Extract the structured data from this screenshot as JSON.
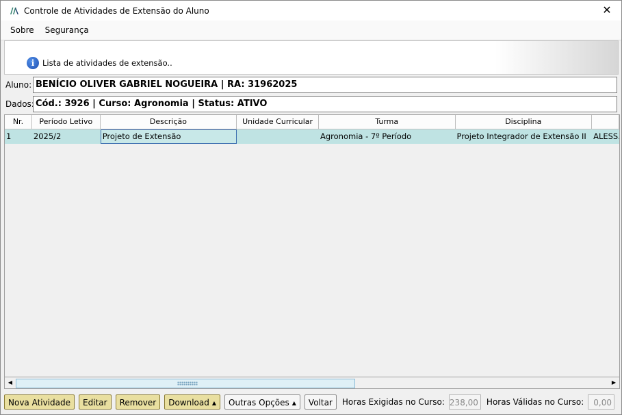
{
  "window": {
    "title": "Controle de Atividades de Extensão do Aluno",
    "close_glyph": "✕"
  },
  "menu": {
    "items": [
      "Sobre",
      "Segurança"
    ]
  },
  "info": {
    "icon": "info-icon",
    "text": "Lista de atividades de extensão.."
  },
  "student": {
    "aluno_label": "Aluno:",
    "aluno_value": "BENÍCIO OLIVER GABRIEL NOGUEIRA | RA: 31962025",
    "dados_label": "Dados:",
    "dados_value": "Cód.: 3926 | Curso: Agronomia | Status: ATIVO"
  },
  "grid": {
    "columns": [
      "Nr.",
      "Período Letivo",
      "Descrição",
      "Unidade Curricular",
      "Turma",
      "Disciplina",
      ""
    ],
    "rows": [
      [
        "1",
        "2025/2",
        "Projeto de Extensão",
        "",
        "Agronomia - 7º Período",
        "Projeto Integrador de Extensão II",
        "ALESS."
      ]
    ]
  },
  "scrollbar": {
    "left_arrow": "◀",
    "right_arrow": "▶"
  },
  "toolbar": {
    "nova_atividade": "Nova Atividade",
    "editar": "Editar",
    "remover": "Remover",
    "download": "Download",
    "outras_opcoes": "Outras Opções",
    "voltar": "Voltar",
    "horas_exigidas_label": "Horas Exigidas no Curso:",
    "horas_exigidas_value": "238,00",
    "horas_validas_label": "Horas Válidas no Curso:",
    "horas_validas_value": "0,00",
    "caret": "▲"
  },
  "colors": {
    "selected_row": "#bfe3e3",
    "button_bg": "#e9dfa0",
    "info_icon": "#1f4fb0"
  }
}
